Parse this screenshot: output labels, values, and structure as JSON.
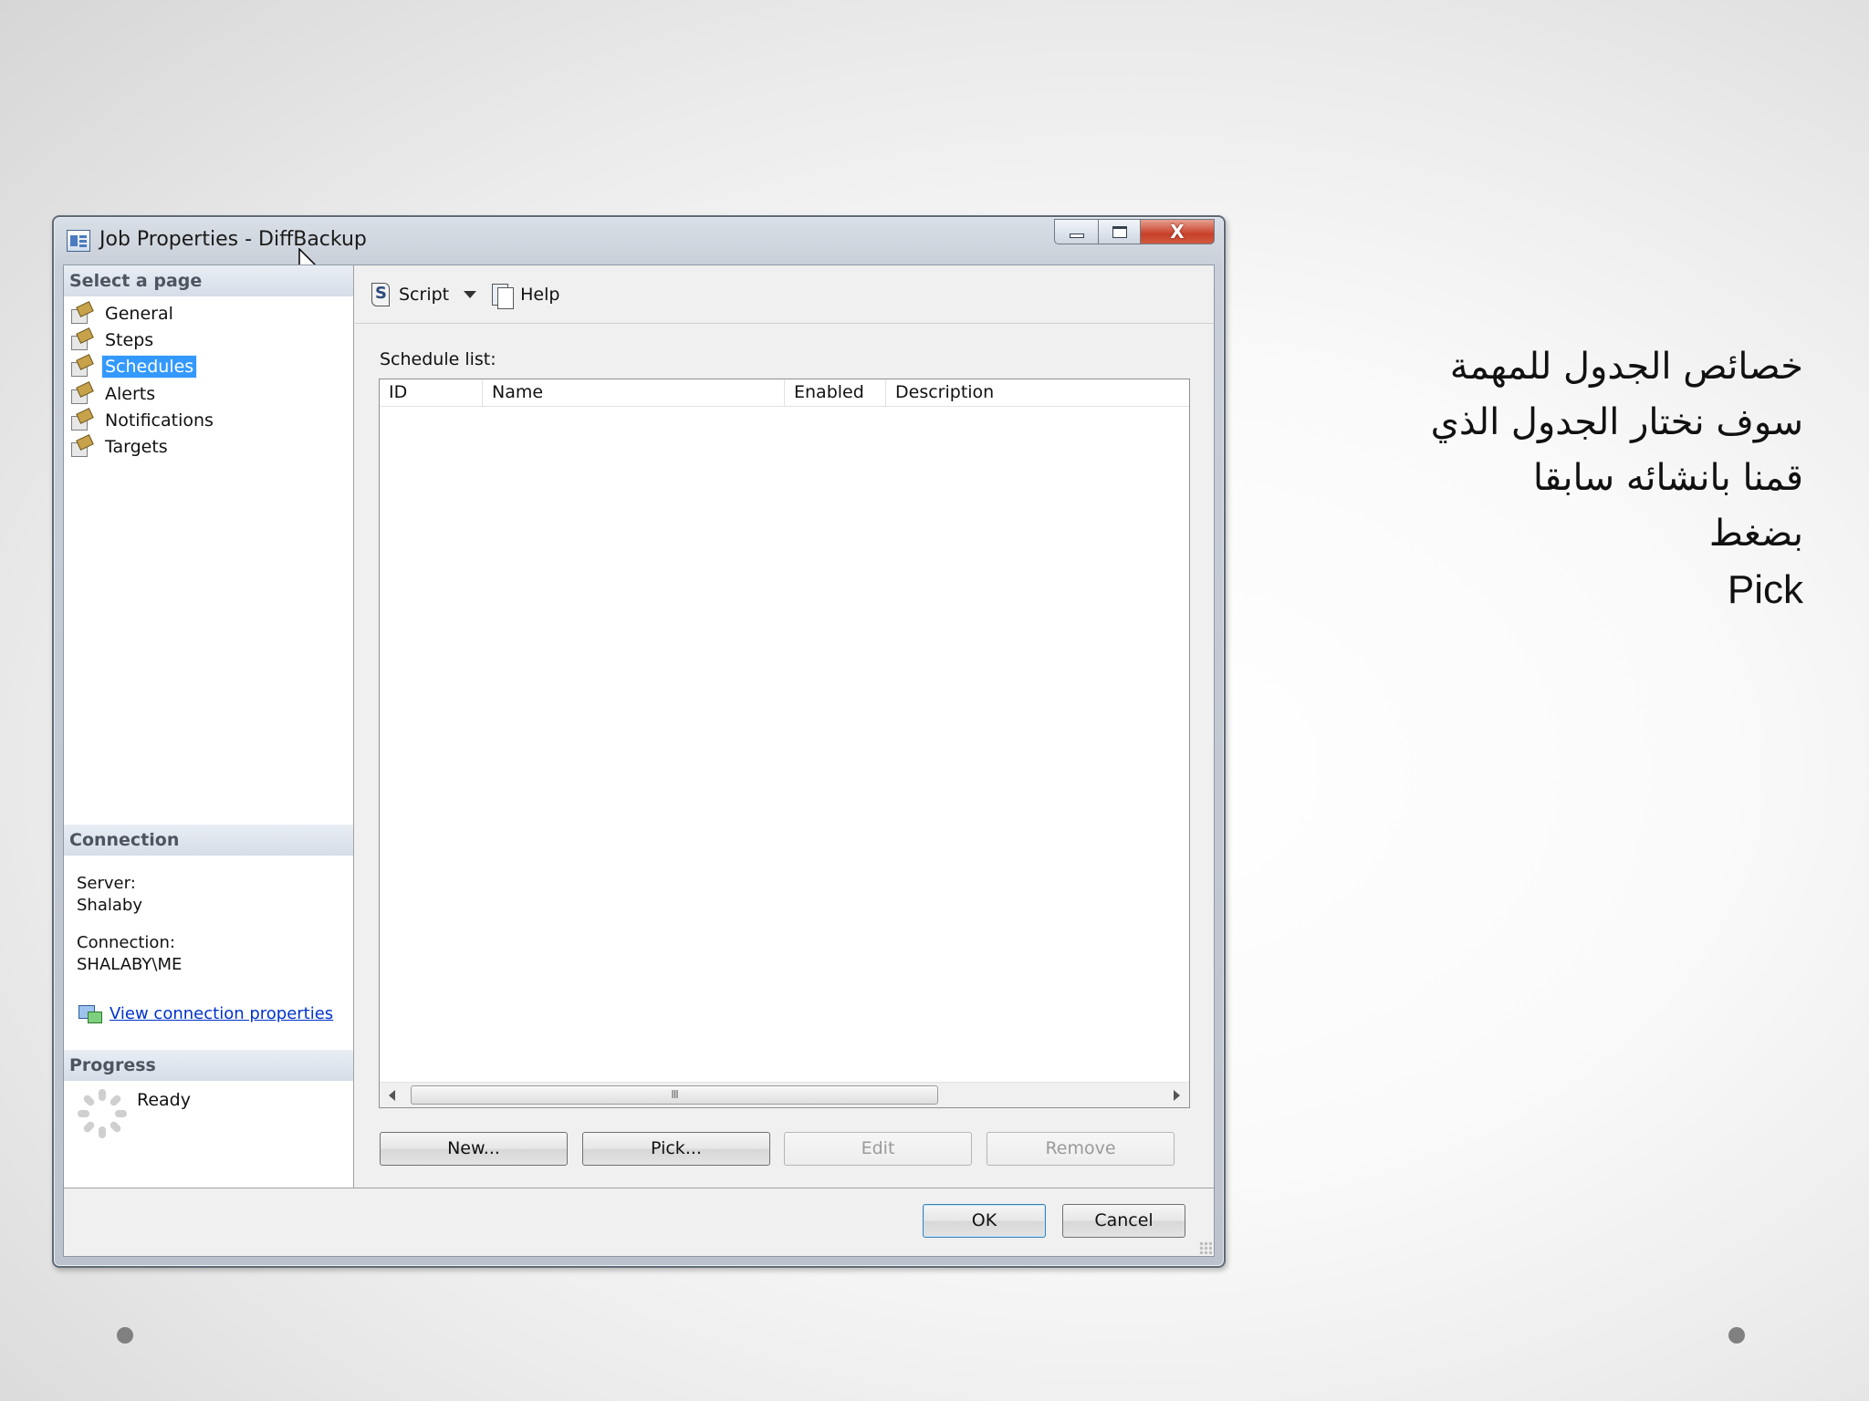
{
  "window": {
    "title": "Job Properties - DiffBackup",
    "controls": {
      "minimize": "minimize",
      "maximize": "maximize",
      "close": "X"
    }
  },
  "left_pane": {
    "select_page_header": "Select a page",
    "pages": [
      {
        "label": "General",
        "selected": false
      },
      {
        "label": "Steps",
        "selected": false
      },
      {
        "label": "Schedules",
        "selected": true
      },
      {
        "label": "Alerts",
        "selected": false
      },
      {
        "label": "Notifications",
        "selected": false
      },
      {
        "label": "Targets",
        "selected": false
      }
    ],
    "connection_header": "Connection",
    "server_label": "Server:",
    "server_value": "Shalaby",
    "connection_label": "Connection:",
    "connection_value": "SHALABY\\ME",
    "view_connection_link": "View connection properties",
    "progress_header": "Progress",
    "progress_status": "Ready"
  },
  "toolbar": {
    "script_label": "Script",
    "help_label": "Help"
  },
  "schedule_list": {
    "label": "Schedule list:",
    "columns": [
      "ID",
      "Name",
      "Enabled",
      "Description"
    ],
    "rows": [],
    "scroll_thumb": "III"
  },
  "buttons": {
    "new": "New...",
    "pick": "Pick...",
    "edit": "Edit",
    "remove": "Remove",
    "ok": "OK",
    "cancel": "Cancel"
  },
  "caption": {
    "lines": [
      "خصائص الجدول للمهمة",
      "سوف نختار الجدول الذي",
      "قمنا بانشائه سابقا",
      "بضغط",
      "Pick"
    ]
  },
  "colors": {
    "selection": "#3399ff",
    "link": "#0033cc",
    "close_button": "#c7402a"
  }
}
